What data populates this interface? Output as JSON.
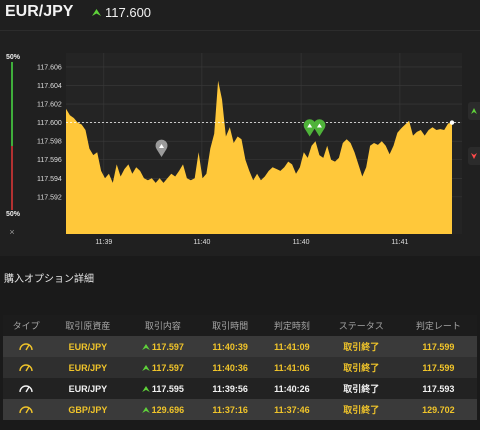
{
  "header": {
    "pair": "EUR/JPY",
    "rate": "117.600",
    "rate_direction": "up-arrow-icon",
    "up_color": "#5fd23a"
  },
  "side_panel": {
    "top_pct": "50%",
    "bottom_pct": "50%",
    "close_label": "×",
    "up_color": "#3fae3b",
    "down_color": "#b23131"
  },
  "chart_data": {
    "type": "area",
    "series_color": "#ffc83a",
    "y_ticks": [
      "117.606",
      "117.604",
      "117.602",
      "117.600",
      "117.598",
      "117.596",
      "117.594",
      "117.592"
    ],
    "x_ticks": [
      "11:39",
      "11:40",
      "11:40",
      "11:41"
    ],
    "current_rate_line": 117.6,
    "ylim": [
      117.588,
      117.6075
    ],
    "grid": true,
    "x": [
      0,
      2,
      4,
      6,
      8,
      10,
      12,
      14,
      16,
      18,
      20,
      22,
      24,
      26,
      28,
      30,
      32,
      34,
      36,
      38,
      40,
      42,
      44,
      46,
      48,
      50,
      52,
      54,
      56,
      58,
      60,
      62,
      64,
      66,
      68,
      70,
      72,
      74,
      76,
      78,
      80,
      82,
      84,
      86,
      88,
      90,
      92,
      94,
      96,
      98,
      100,
      102,
      104,
      106,
      108,
      110,
      112,
      114,
      116,
      118,
      120,
      122,
      124,
      126,
      128,
      130,
      132,
      134,
      136,
      138,
      140,
      142,
      144,
      146,
      148,
      150,
      152,
      154,
      156,
      158,
      160,
      162,
      164,
      166,
      168,
      170,
      172,
      174,
      176,
      178,
      180,
      182,
      184,
      186,
      188,
      190,
      192,
      194,
      196,
      198
    ],
    "values": [
      117.6015,
      117.6008,
      117.6005,
      117.6,
      117.5998,
      117.5992,
      117.5972,
      117.5965,
      117.5968,
      117.5948,
      117.594,
      117.5945,
      117.5935,
      117.5955,
      117.5942,
      117.595,
      117.5955,
      117.5945,
      117.5952,
      117.5948,
      117.594,
      117.5938,
      117.594,
      117.5935,
      117.594,
      117.5935,
      117.594,
      117.5945,
      117.5942,
      117.5948,
      117.5955,
      117.594,
      117.5938,
      117.594,
      117.5968,
      117.594,
      117.5945,
      117.5972,
      117.5988,
      117.6045,
      117.6025,
      117.5985,
      117.5995,
      117.5978,
      117.5985,
      117.5982,
      117.596,
      117.5948,
      117.5938,
      117.5945,
      117.5938,
      117.5942,
      117.5948,
      117.5952,
      117.595,
      117.5948,
      117.5952,
      117.5958,
      117.5955,
      117.5945,
      117.5952,
      117.5968,
      117.5962,
      117.5975,
      117.598,
      117.5965,
      117.5962,
      117.5975,
      117.596,
      117.5958,
      117.5962,
      117.5978,
      117.5982,
      117.5978,
      117.5968,
      117.5955,
      117.5942,
      117.5952,
      117.5975,
      117.5978,
      117.5976,
      117.598,
      117.5975,
      117.5966,
      117.5975,
      117.5989,
      117.5994,
      117.5998,
      117.6002,
      117.5986,
      117.599,
      117.5992,
      117.5986,
      117.5992,
      117.5995,
      117.5992,
      117.5993,
      117.5992,
      117.5999,
      117.6
    ]
  },
  "markers": [
    {
      "name": "gray-marker-icon",
      "x": 49,
      "value": 117.5963,
      "color": "#9a9a9a"
    },
    {
      "name": "green-marker-icon",
      "x": 125,
      "value": 117.5985,
      "color": "#4fb33a"
    },
    {
      "name": "green-marker-icon-2",
      "x": 130,
      "value": 117.5985,
      "color": "#4fb33a"
    }
  ],
  "side_tabs": {
    "up_color": "#5fd23a",
    "down_color": "#ff4a4a"
  },
  "details": {
    "title": "購入オプション詳細",
    "columns": [
      "タイプ",
      "取引原資産",
      "取引内容",
      "取引時間",
      "判定時刻",
      "ステータス",
      "判定レート"
    ],
    "rows": [
      {
        "asset": "EUR/JPY",
        "content": "117.597",
        "direction": "up",
        "time": "11:40:39",
        "judge_time": "11:41:09",
        "status": "取引終了",
        "judge_rate": "117.599",
        "style": "odd"
      },
      {
        "asset": "EUR/JPY",
        "content": "117.597",
        "direction": "up",
        "time": "11:40:36",
        "judge_time": "11:41:06",
        "status": "取引終了",
        "judge_rate": "117.599",
        "style": "even"
      },
      {
        "asset": "EUR/JPY",
        "content": "117.595",
        "direction": "up",
        "time": "11:39:56",
        "judge_time": "11:40:26",
        "status": "取引終了",
        "judge_rate": "117.593",
        "style": "plain"
      },
      {
        "asset": "GBP/JPY",
        "content": "129.696",
        "direction": "up",
        "time": "11:37:16",
        "judge_time": "11:37:46",
        "status": "取引終了",
        "judge_rate": "129.702",
        "style": "odd"
      }
    ]
  }
}
